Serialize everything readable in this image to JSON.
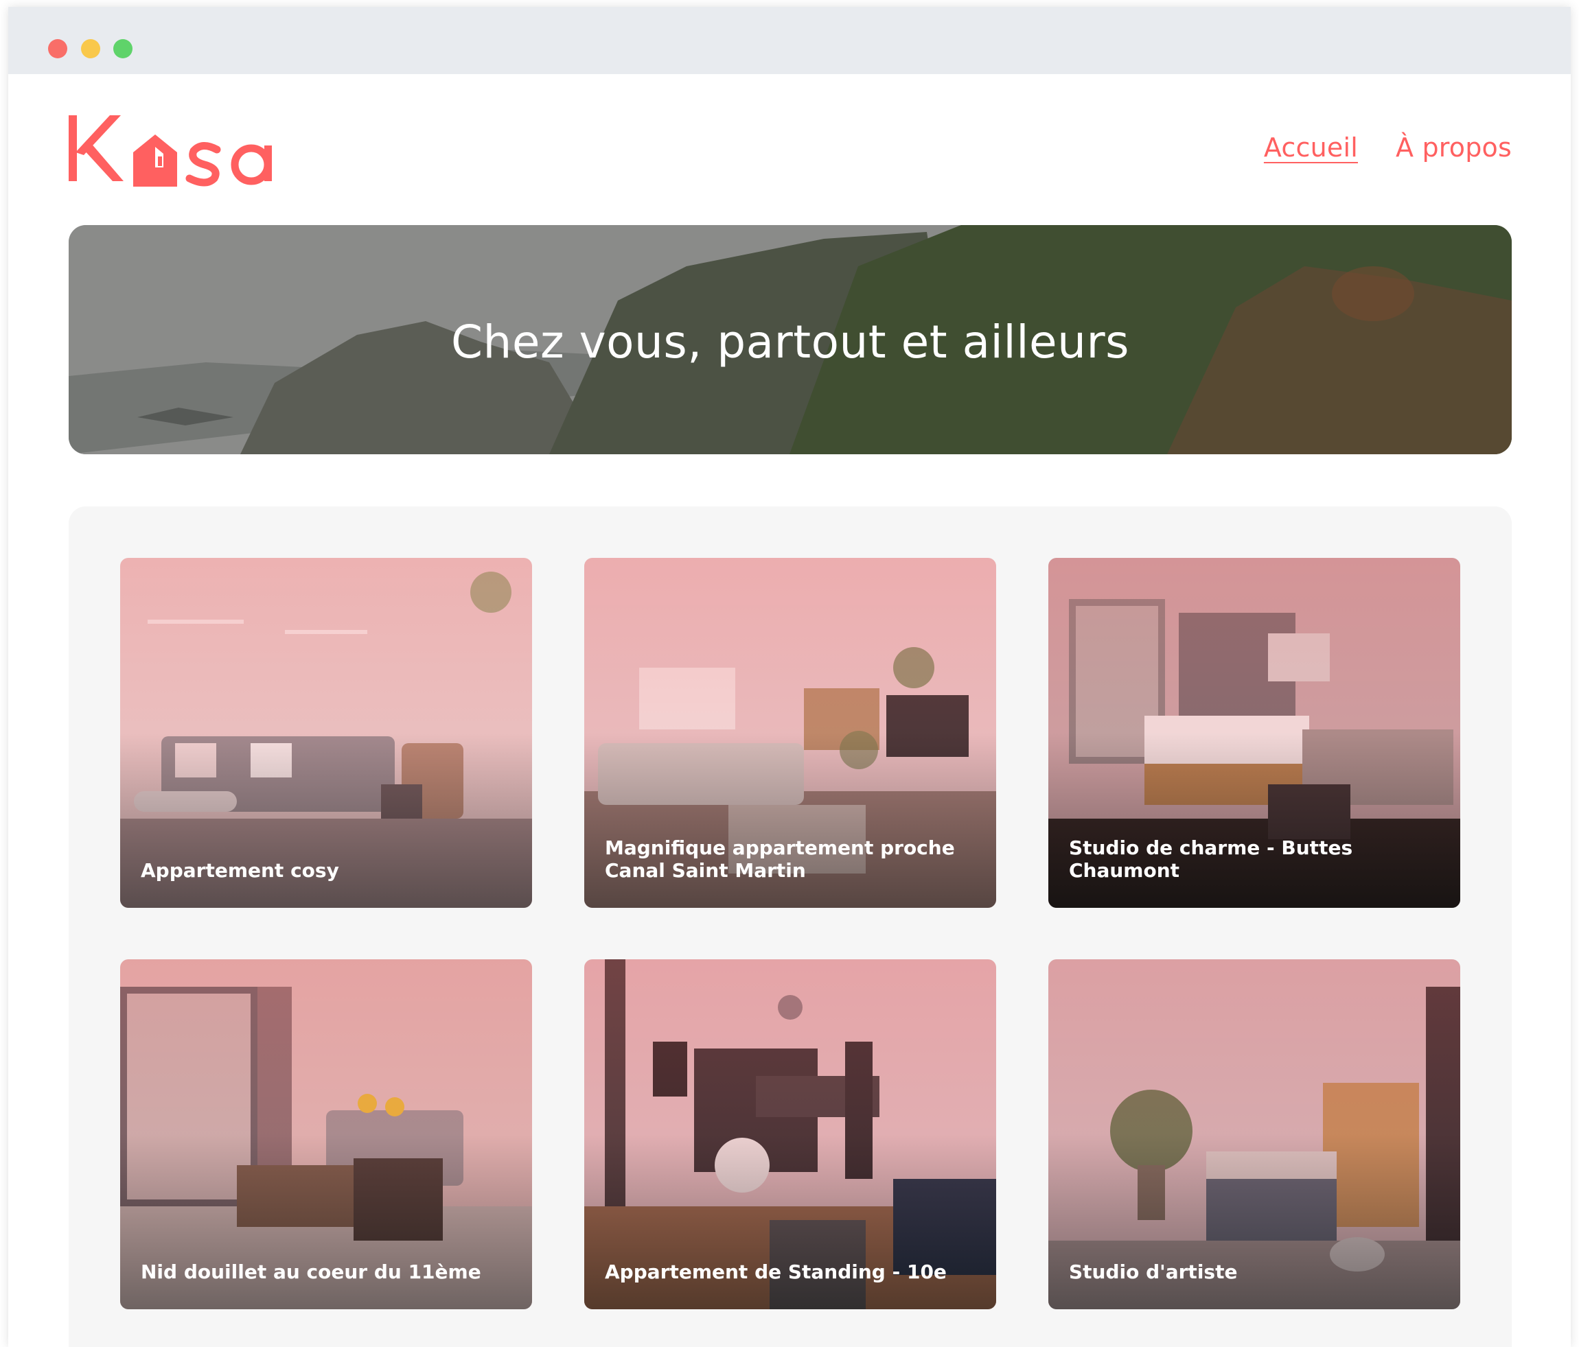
{
  "brand": {
    "name": "Kasa",
    "color": "#ff6060"
  },
  "nav": {
    "items": [
      {
        "label": "Accueil",
        "active": true
      },
      {
        "label": "À propos",
        "active": false
      }
    ]
  },
  "banner": {
    "title": "Chez vous, partout et ailleurs"
  },
  "listings": [
    {
      "title": "Appartement cosy"
    },
    {
      "title": "Magnifique appartement proche Canal Saint Martin"
    },
    {
      "title": "Studio de charme - Buttes Chaumont"
    },
    {
      "title": "Nid douillet au coeur du 11ème"
    },
    {
      "title": "Appartement de Standing - 10e"
    },
    {
      "title": "Studio d'artiste"
    }
  ]
}
